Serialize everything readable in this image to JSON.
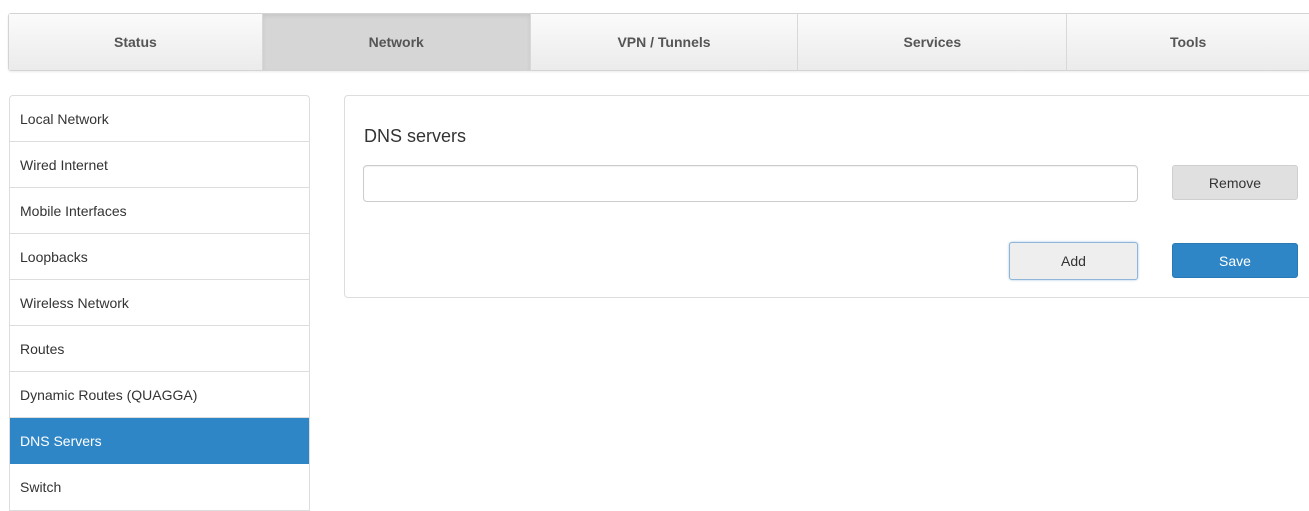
{
  "top_nav": {
    "tabs": [
      {
        "label": "Status"
      },
      {
        "label": "Network"
      },
      {
        "label": "VPN / Tunnels"
      },
      {
        "label": "Services"
      },
      {
        "label": "Tools"
      }
    ],
    "active": "Network"
  },
  "sidebar": {
    "items": [
      {
        "label": "Local Network"
      },
      {
        "label": "Wired Internet"
      },
      {
        "label": "Mobile Interfaces"
      },
      {
        "label": "Loopbacks"
      },
      {
        "label": "Wireless Network"
      },
      {
        "label": "Routes"
      },
      {
        "label": "Dynamic Routes (QUAGGA)"
      },
      {
        "label": "DNS Servers"
      },
      {
        "label": "Switch"
      }
    ],
    "active": "DNS Servers"
  },
  "panel": {
    "title": "DNS servers",
    "dns_input": {
      "value": "",
      "placeholder": ""
    },
    "remove_label": "Remove",
    "add_label": "Add",
    "save_label": "Save"
  },
  "colors": {
    "accent": "#2f86c6",
    "active_tab": "#d6d6d6",
    "remove_button": "#e0e0e0"
  }
}
